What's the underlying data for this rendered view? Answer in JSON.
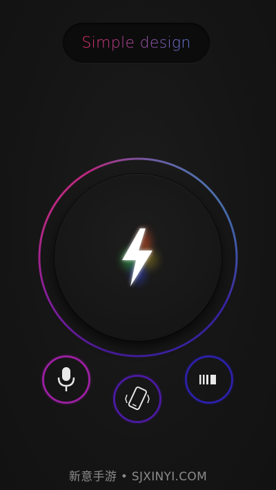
{
  "header": {
    "title": "Simple design"
  },
  "power": {
    "icon": "lightning-bolt-icon"
  },
  "modes": [
    {
      "name": "microphone",
      "icon": "microphone-icon",
      "color": "#9a1fa0"
    },
    {
      "name": "shake",
      "icon": "phone-shake-icon",
      "color": "#4a1aa0"
    },
    {
      "name": "strobe",
      "icon": "strobe-bars-icon",
      "color": "#2c20a8"
    }
  ],
  "ring_gradient": [
    "#9a1fa0",
    "#e0306a",
    "#3a8fb0",
    "#3a2aa8"
  ],
  "footer": {
    "watermark": "新意手游 • SJXINYI.COM"
  }
}
